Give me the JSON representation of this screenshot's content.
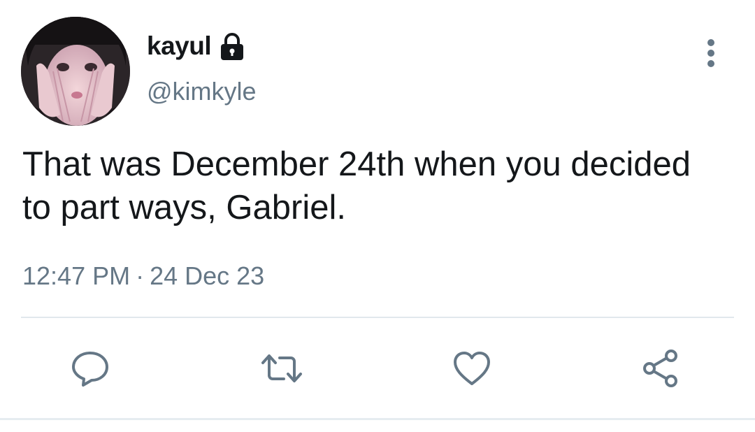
{
  "user": {
    "display_name": "kayul",
    "handle": "@kimkyle",
    "protected_icon": "lock-icon",
    "avatar": "avatar-photo"
  },
  "tweet": {
    "text": "That was December 24th when you decided to part ways, Gabriel.",
    "time": "12:47 PM",
    "separator": "·",
    "date": "24 Dec 23"
  },
  "actions": {
    "reply_icon": "reply-icon",
    "retweet_icon": "retweet-icon",
    "like_icon": "heart-icon",
    "share_icon": "share-icon",
    "more_icon": "more-vertical-icon"
  },
  "colors": {
    "text_primary": "#14171a",
    "text_secondary": "#657786",
    "divider": "#e1e8ed"
  }
}
